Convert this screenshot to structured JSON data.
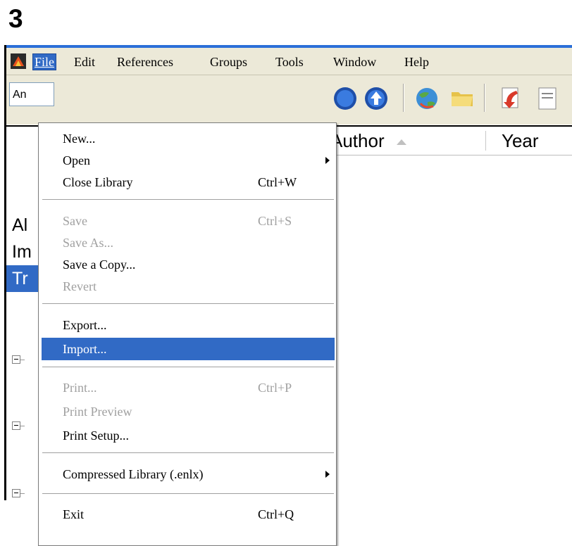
{
  "step_number": "3",
  "menubar": {
    "items": [
      "File",
      "Edit",
      "References",
      "Groups",
      "Tools",
      "Window",
      "Help"
    ]
  },
  "toolbar": {
    "style_field_value": "An"
  },
  "columns": {
    "author": "Author",
    "year": "Year"
  },
  "groups": {
    "items": [
      "Al",
      "Im",
      "Tr"
    ]
  },
  "file_menu": {
    "new": "New...",
    "open": "Open",
    "close_library": "Close Library",
    "close_library_shortcut": "Ctrl+W",
    "save": "Save",
    "save_shortcut": "Ctrl+S",
    "save_as": "Save As...",
    "save_a_copy": "Save a Copy...",
    "revert": "Revert",
    "export": "Export...",
    "import": "Import...",
    "print": "Print...",
    "print_shortcut": "Ctrl+P",
    "print_preview": "Print Preview",
    "print_setup": "Print Setup...",
    "compressed_library": "Compressed Library (.enlx)",
    "exit": "Exit",
    "exit_shortcut": "Ctrl+Q"
  },
  "colors": {
    "highlight": "#316ac5",
    "menubar_bg": "#ece9d8",
    "disabled_text": "#a0a0a0"
  }
}
